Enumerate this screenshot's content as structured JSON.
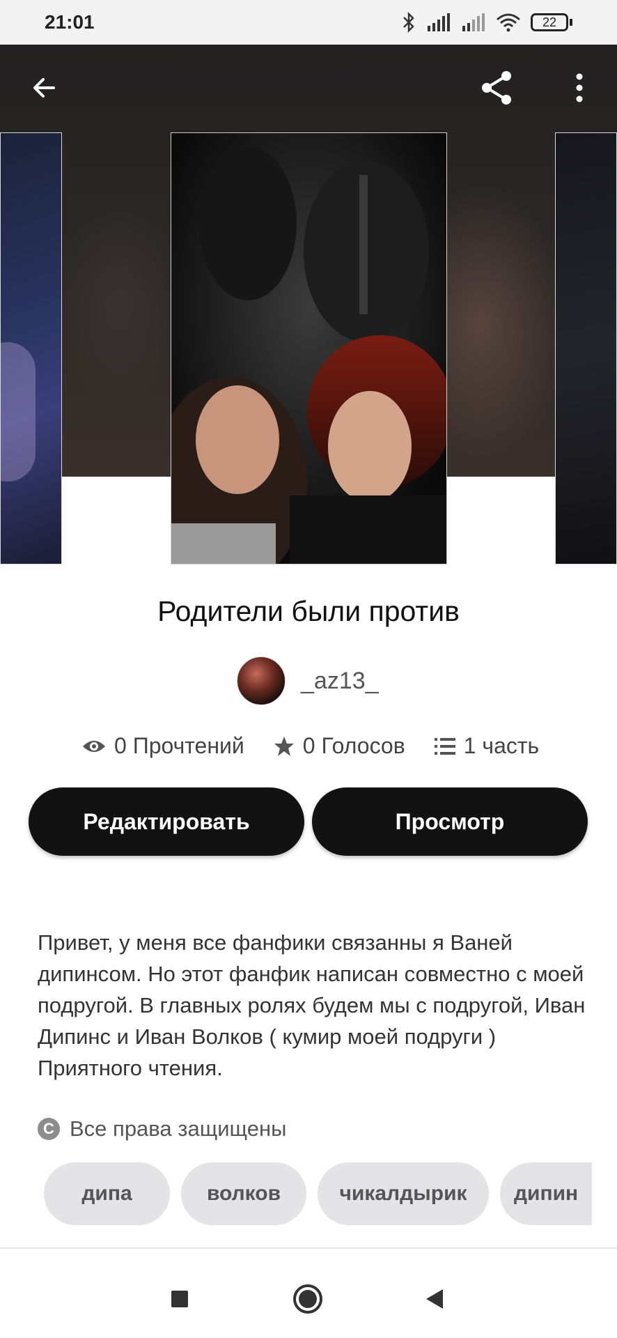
{
  "status_bar": {
    "time": "21:01",
    "battery": "22",
    "icons": [
      "bluetooth-icon",
      "signal-icon",
      "signal-weak-icon",
      "wifi-icon",
      "battery-icon"
    ]
  },
  "top_bar": {
    "back_icon": "arrow-left-icon",
    "share_icon": "share-icon",
    "more_icon": "more-vertical-icon"
  },
  "story": {
    "title": "Родители были против",
    "author": "_az13_",
    "stats": {
      "reads": "0 Прочтений",
      "votes": "0 Голосов",
      "parts": "1 часть"
    },
    "buttons": {
      "edit": "Редактировать",
      "view": "Просмотр"
    },
    "description": "Привет, у меня все фанфики связанны я Ваней дипинсом. Но этот фанфик написан совместно с моей подругой. В главных ролях будем мы с подругой, Иван Дипинс и Иван Волков ( кумир моей подруги ) Приятного чтения.",
    "rights_icon_glyph": "C",
    "rights": "Все права защищены",
    "tags": [
      "дипа",
      "волков",
      "чикалдырик",
      "дипин"
    ]
  },
  "nav": {
    "icons": [
      "recents-square-icon",
      "home-circle-icon",
      "back-triangle-icon"
    ]
  },
  "colors": {
    "button_bg": "#121212",
    "tag_bg": "#e4e4e7",
    "hero_bg": "#232121"
  }
}
